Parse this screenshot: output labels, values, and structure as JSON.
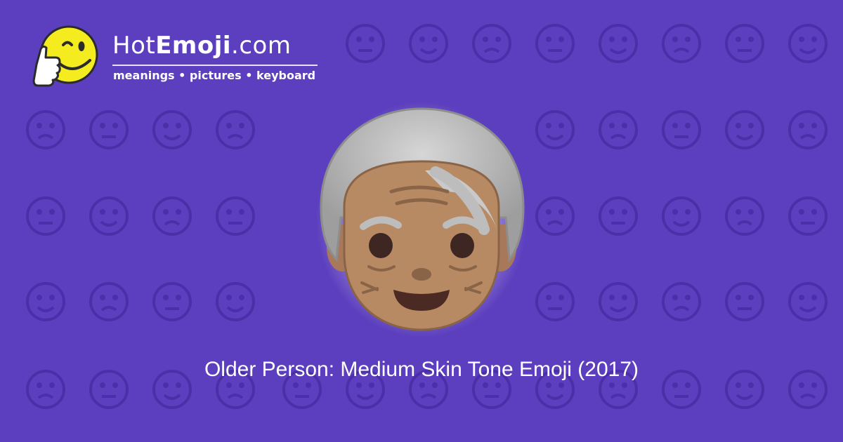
{
  "background_color": "#5c3fbe",
  "pattern_color": "#4a2fa8",
  "logo": {
    "brand_prefix": "Hot",
    "brand_bold": "Emoji",
    "brand_suffix": ".com",
    "tagline": "meanings • pictures • keyboard",
    "mascot_icon": "thumbs-up-winking-face-icon",
    "mascot_color": "#f5ec1f"
  },
  "hero_emoji": {
    "icon": "older-person-medium-skin-tone-icon",
    "skin_color": "#b78a64",
    "hair_color": "#bdbdbd"
  },
  "caption": "Older Person: Medium Skin Tone Emoji (2017)"
}
